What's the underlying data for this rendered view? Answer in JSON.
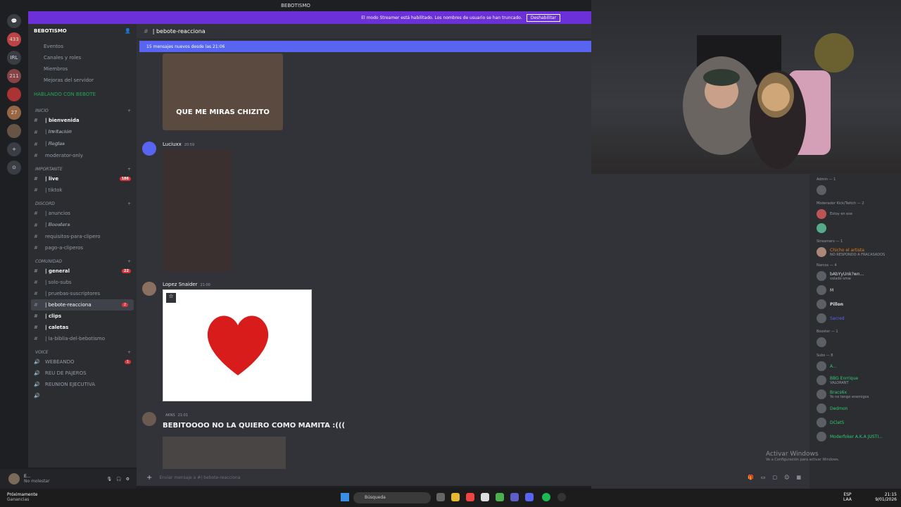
{
  "window": {
    "title": "BEBOTISMO"
  },
  "streamer_banner": {
    "text": "El modo Streamer está habilitado. Los nombres de usuario se han truncado.",
    "button": "Deshabilitar"
  },
  "guilds": [
    "433",
    "IRL",
    "211",
    "27",
    "+"
  ],
  "server": {
    "name": "BEBOTISMO",
    "nav": [
      "Eventos",
      "Canales y roles",
      "Miembros",
      "Mejoras del servidor"
    ],
    "special": "HABLANDO CON BEBOTE",
    "categories": [
      {
        "name": "INICIO",
        "channels": [
          {
            "label": "| bienvenida",
            "bold": true
          },
          {
            "label": "| 𝑰𝒏𝒗𝒊𝒕𝒂𝒄𝒊𝒐́𝒏"
          },
          {
            "label": "| 𝑹𝒆𝒈𝒍𝒂𝒔"
          },
          {
            "label": "moderator-only"
          }
        ]
      },
      {
        "name": "IMPORTANTE",
        "channels": [
          {
            "label": "| live",
            "bold": true,
            "badge": "186"
          },
          {
            "label": "| tiktok"
          }
        ]
      },
      {
        "name": "DISCORD",
        "channels": [
          {
            "label": "| anuncios"
          },
          {
            "label": "| 𝑩𝒐𝒐𝒔𝒕𝒆𝒓𝒔"
          },
          {
            "label": "requisitos-para-clipero"
          },
          {
            "label": "pago-a-cliperos"
          }
        ]
      },
      {
        "name": "COMUNIDAD",
        "channels": [
          {
            "label": "| general",
            "bold": true,
            "badge": "22"
          },
          {
            "label": "| solo-subs"
          },
          {
            "label": "| pruebas-suscriptores"
          },
          {
            "label": "| bebote-reacciona",
            "active": true,
            "badge": "2"
          },
          {
            "label": "| clips",
            "bold": true
          },
          {
            "label": "| caletas",
            "bold": true
          },
          {
            "label": "| la-biblia-del-bebotismo"
          }
        ]
      },
      {
        "name": "VOICE",
        "channels": [
          {
            "label": "WEBEANDO",
            "badge": "1"
          },
          {
            "label": "REU DE PAJEROS"
          },
          {
            "label": "REUNION EJECUTIVA"
          },
          {
            "label": ""
          }
        ]
      }
    ]
  },
  "user": {
    "name": "E...",
    "status": "No molestar"
  },
  "channel": {
    "name": "| bebote-reacciona",
    "new_messages": "15 mensajes nuevos desde las 21:06",
    "input_placeholder": "Enviar mensaje a #| bebote-reacciona"
  },
  "messages": [
    {
      "caption": "QUE ME MIRAS CHIZITO"
    },
    {
      "author": "Luciuxx",
      "time": "20:59"
    },
    {
      "author": "Lopez Snaider",
      "time": "21:00"
    },
    {
      "author": "",
      "tag": "AKNS",
      "time": "21:01",
      "text": "BEBITOOOO NO LA QUIERO COMO MAMITA :((("
    }
  ],
  "members": {
    "groups": [
      {
        "name": "Admin — 1",
        "list": [
          {
            "name": "",
            "color": "#c9cdfb"
          }
        ]
      },
      {
        "name": "Moderador Kick/Twitch — 2",
        "list": [
          {
            "name": "",
            "color": "#3d5afe",
            "sub": "Estoy en ese"
          },
          {
            "name": "",
            "color": "#3d5afe"
          }
        ]
      },
      {
        "name": "Streamers — 1",
        "list": [
          {
            "name": "Chicho el artista",
            "color": "#e67e22",
            "sub": "NO RESPONDO A FRACASADOS"
          }
        ]
      },
      {
        "name": "Narcos — 4",
        "list": [
          {
            "name": "bAbYyUnk?wn...",
            "color": "#dbdee1",
            "sub": "volado smw"
          },
          {
            "name": "M",
            "color": "#dbdee1"
          },
          {
            "name": "Pillon",
            "color": "#dbdee1"
          },
          {
            "name": "Sacred",
            "color": "#dbdee1"
          }
        ]
      },
      {
        "name": "Booster — 1",
        "list": [
          {
            "name": "",
            "color": "#f47fff"
          }
        ]
      },
      {
        "name": "Subs — 8",
        "list": [
          {
            "name": "A...",
            "color": "#2ecc71"
          },
          {
            "name": "BBG Enrrique",
            "color": "#2ecc71",
            "sub": "VALORANT"
          },
          {
            "name": "Bracs6x",
            "color": "#2ecc71",
            "sub": "Yo no tengo enemigos"
          },
          {
            "name": "Dedmon",
            "color": "#2ecc71"
          },
          {
            "name": "DClet5",
            "color": "#2ecc71"
          },
          {
            "name": "Moderfoker A.K.A JUSTI...",
            "color": "#2ecc71"
          }
        ]
      }
    ]
  },
  "watermark": {
    "title": "Activar Windows",
    "sub": "Ve a Configuración para activar Windows."
  },
  "taskbar": {
    "weather_title": "Próximamente",
    "weather_sub": "Ganancias",
    "search": "Búsqueda",
    "lang1": "ESP",
    "lang2": "LAA",
    "time": "21:15",
    "date": "9/01/2026"
  },
  "colors": {
    "accent": "#5865f2",
    "streamer": "#6c30d8",
    "badge": "#da373c"
  }
}
